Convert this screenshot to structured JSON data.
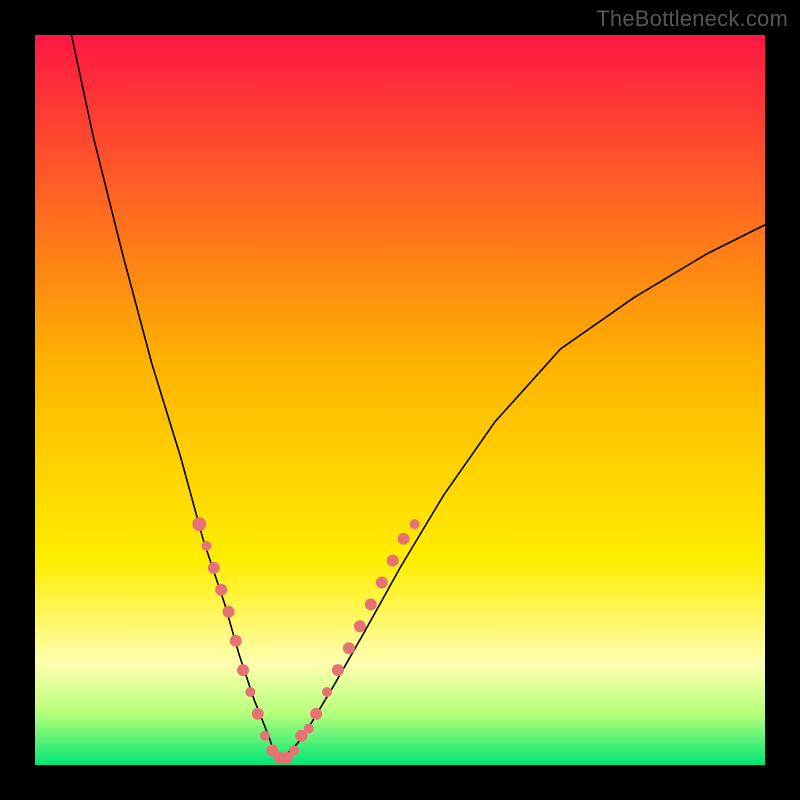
{
  "watermark": "TheBottleneck.com",
  "colors": {
    "frame_background": "#000000",
    "gradient_stops": [
      "#ff1744",
      "#ffb300",
      "#ffee00",
      "#ffffb0",
      "#b6ff7a",
      "#00e676"
    ],
    "curve": "#000000",
    "dots": "#e57373"
  },
  "chart_data": {
    "type": "line",
    "title": "",
    "xlabel": "",
    "ylabel": "",
    "xlim": [
      0,
      100
    ],
    "ylim": [
      0,
      100
    ],
    "description": "Absolute V-shaped bottleneck curve with minimum near x≈33. Background gradient encodes severity (red=high, green=zero). Salmon dots mark sampled points on both arms near the trough.",
    "curve": {
      "x": [
        5,
        8,
        12,
        16,
        20,
        23,
        26,
        28,
        30,
        32,
        33,
        34,
        36,
        38,
        41,
        45,
        50,
        56,
        63,
        72,
        82,
        92,
        100
      ],
      "y": [
        100,
        86,
        70,
        55,
        42,
        31,
        22,
        15,
        9,
        4,
        1,
        1,
        3,
        6,
        11,
        18,
        27,
        37,
        47,
        57,
        64,
        70,
        74
      ]
    },
    "dots": [
      {
        "x": 22.5,
        "y": 33,
        "r": 7
      },
      {
        "x": 23.5,
        "y": 30,
        "r": 5
      },
      {
        "x": 24.5,
        "y": 27,
        "r": 6
      },
      {
        "x": 25.5,
        "y": 24,
        "r": 6
      },
      {
        "x": 26.5,
        "y": 21,
        "r": 6
      },
      {
        "x": 27.5,
        "y": 17,
        "r": 6
      },
      {
        "x": 28.5,
        "y": 13,
        "r": 6
      },
      {
        "x": 29.5,
        "y": 10,
        "r": 5
      },
      {
        "x": 30.5,
        "y": 7,
        "r": 6
      },
      {
        "x": 31.5,
        "y": 4,
        "r": 5
      },
      {
        "x": 32.5,
        "y": 2,
        "r": 6
      },
      {
        "x": 33.5,
        "y": 1,
        "r": 6
      },
      {
        "x": 34.5,
        "y": 1,
        "r": 6
      },
      {
        "x": 35.5,
        "y": 2,
        "r": 5
      },
      {
        "x": 36.5,
        "y": 4,
        "r": 6
      },
      {
        "x": 37.5,
        "y": 5,
        "r": 5
      },
      {
        "x": 38.5,
        "y": 7,
        "r": 6
      },
      {
        "x": 40.0,
        "y": 10,
        "r": 5
      },
      {
        "x": 41.5,
        "y": 13,
        "r": 6
      },
      {
        "x": 43.0,
        "y": 16,
        "r": 6
      },
      {
        "x": 44.5,
        "y": 19,
        "r": 6
      },
      {
        "x": 46.0,
        "y": 22,
        "r": 6
      },
      {
        "x": 47.5,
        "y": 25,
        "r": 6
      },
      {
        "x": 49.0,
        "y": 28,
        "r": 6
      },
      {
        "x": 50.5,
        "y": 31,
        "r": 6
      },
      {
        "x": 52.0,
        "y": 33,
        "r": 5
      }
    ]
  }
}
